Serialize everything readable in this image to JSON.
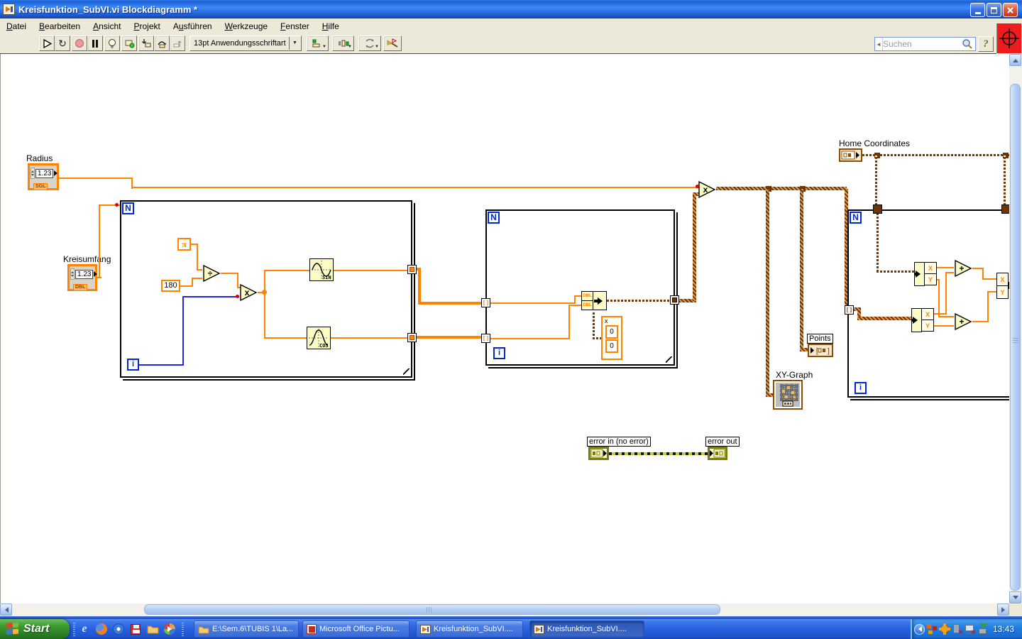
{
  "window": {
    "title": "Kreisfunktion_SubVI.vi Blockdiagramm *"
  },
  "menu": {
    "items": [
      {
        "pre": "",
        "key": "D",
        "post": "atei"
      },
      {
        "pre": "",
        "key": "B",
        "post": "earbeiten"
      },
      {
        "pre": "",
        "key": "A",
        "post": "nsicht"
      },
      {
        "pre": "",
        "key": "P",
        "post": "rojekt"
      },
      {
        "pre": "A",
        "key": "u",
        "post": "sführen"
      },
      {
        "pre": "",
        "key": "W",
        "post": "erkzeuge"
      },
      {
        "pre": "",
        "key": "F",
        "post": "enster"
      },
      {
        "pre": "",
        "key": "H",
        "post": "ilfe"
      }
    ]
  },
  "toolbar": {
    "font": "13pt Anwendungsschriftart",
    "search_placeholder": "Suchen",
    "help": "?"
  },
  "icons": {
    "dropdown": "▼",
    "run_continuous": "↻"
  },
  "diagram": {
    "radius": {
      "label": "Radius",
      "value": "1.23",
      "type": "SGL"
    },
    "kreisumfang": {
      "label": "Kreisumfang",
      "value": "1.23",
      "type": "DBL"
    },
    "home": {
      "label": "Home Coordinates"
    },
    "pi": "π",
    "c180": "180",
    "div": "÷",
    "mul": "x",
    "add": "+",
    "sin": "SIN",
    "cos": "COS",
    "n": "N",
    "i": "i",
    "idx": "[]",
    "dbl": "DBL",
    "x": "X",
    "y": "Y",
    "cluster": {
      "name": "x",
      "v1": "0",
      "v2": "0"
    },
    "xy_graph": "XY-Graph",
    "points": "Points",
    "error_in": "error in (no error)",
    "error_out": "error out"
  },
  "taskbar": {
    "start": "Start",
    "tasks": [
      "E:\\Sem.6\\TUBIS 1\\La...",
      "Microsoft Office Pictu...",
      "Kreisfunktion_SubVI....",
      "Kreisfunktion_SubVI...."
    ],
    "clock": "13:43"
  }
}
